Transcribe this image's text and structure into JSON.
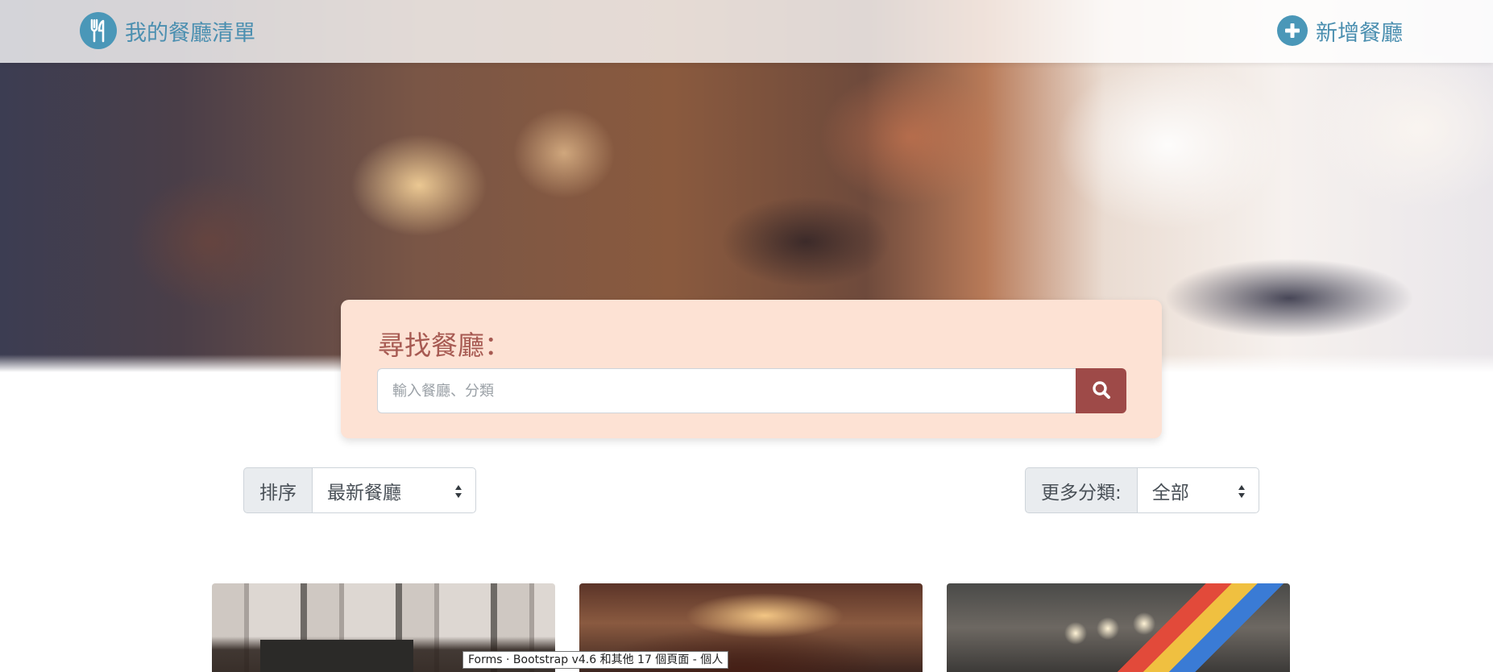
{
  "navbar": {
    "brand_label": "我的餐廳清單",
    "brand_icon": "utensils-icon",
    "add_label": "新增餐廳",
    "add_icon": "plus-circle-icon",
    "accent_color": "#4a97b8"
  },
  "search": {
    "title": "尋找餐廳：",
    "placeholder": "輸入餐廳、分類",
    "button_icon": "search-icon",
    "button_color": "#9e4a48",
    "card_color": "#fde2d4"
  },
  "sort": {
    "label": "排序",
    "selected": "最新餐廳"
  },
  "category": {
    "label": "更多分類:",
    "selected": "全部"
  },
  "cards": [
    {
      "image": "restaurant-photo-storefront"
    },
    {
      "image": "restaurant-photo-dining-hall"
    },
    {
      "image": "restaurant-photo-interior"
    }
  ],
  "tooltip": {
    "text": "Forms · Bootstrap v4.6 和其他 17 個頁面 - 個人"
  }
}
